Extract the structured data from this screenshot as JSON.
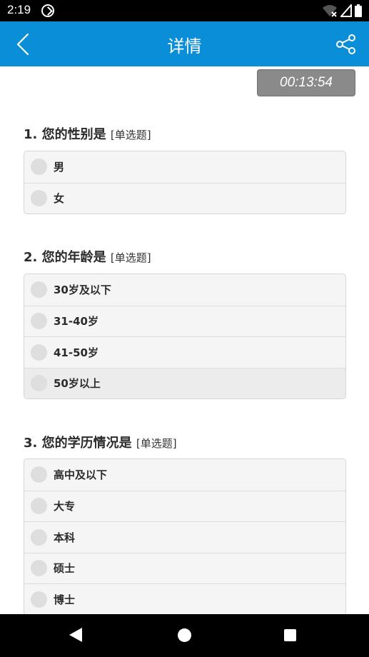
{
  "status_bar": {
    "time": "2:19",
    "icons": [
      "app-notification-icon",
      "wifi-off-icon",
      "signal-icon",
      "battery-icon"
    ]
  },
  "app_bar": {
    "title": "详情",
    "back_icon": "chevron-left-icon",
    "share_icon": "share-icon",
    "background": "#0b8ed8"
  },
  "timer": "00:13:54",
  "questions": [
    {
      "title": "1. 您的性别是",
      "type": "[单选题]",
      "options": [
        "男",
        "女"
      ]
    },
    {
      "title": "2. 您的年龄是",
      "type": "[单选题]",
      "options": [
        "30岁及以下",
        "31-40岁",
        "41-50岁",
        "50岁以上"
      ]
    },
    {
      "title": "3. 您的学历情况是",
      "type": "[单选题]",
      "options": [
        "高中及以下",
        "大专",
        "本科",
        "硕士",
        "博士"
      ]
    }
  ],
  "nav_bar": {
    "icons": [
      "nav-back-icon",
      "nav-home-icon",
      "nav-recents-icon"
    ]
  }
}
